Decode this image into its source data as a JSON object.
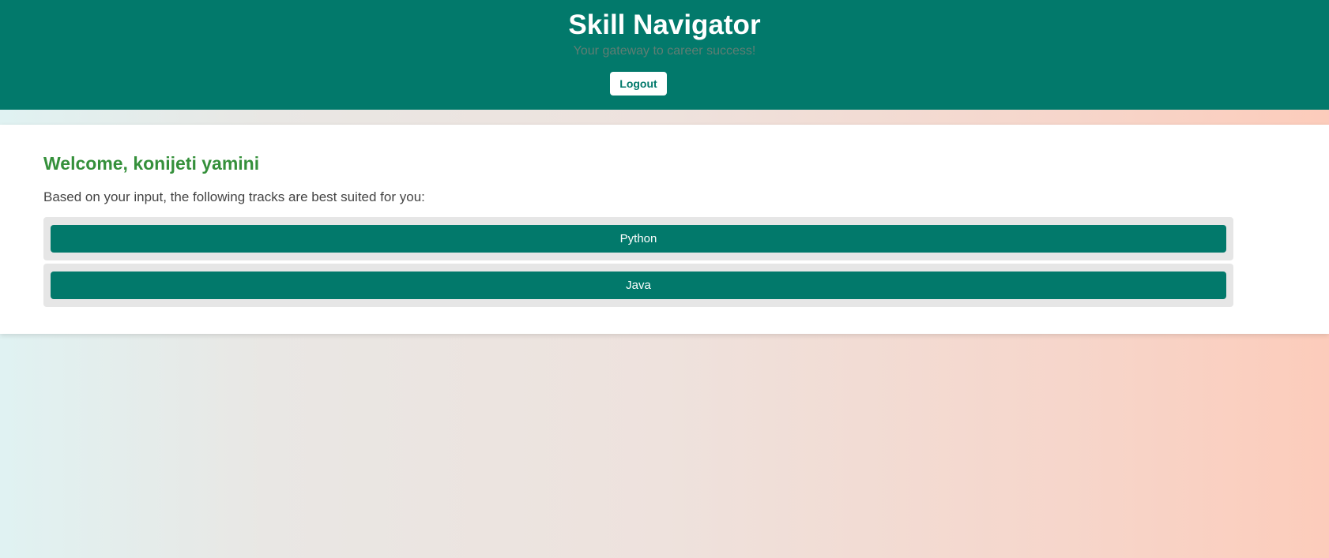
{
  "header": {
    "title": "Skill Navigator",
    "subtitle": "Your gateway to career success!",
    "logout_label": "Logout"
  },
  "main": {
    "welcome": "Welcome, konijeti yamini",
    "intro": "Based on your input, the following tracks are best suited for you:",
    "tracks": [
      {
        "label": "Python"
      },
      {
        "label": "Java"
      }
    ]
  },
  "colors": {
    "brand": "#02796b",
    "heading": "#35903b"
  }
}
